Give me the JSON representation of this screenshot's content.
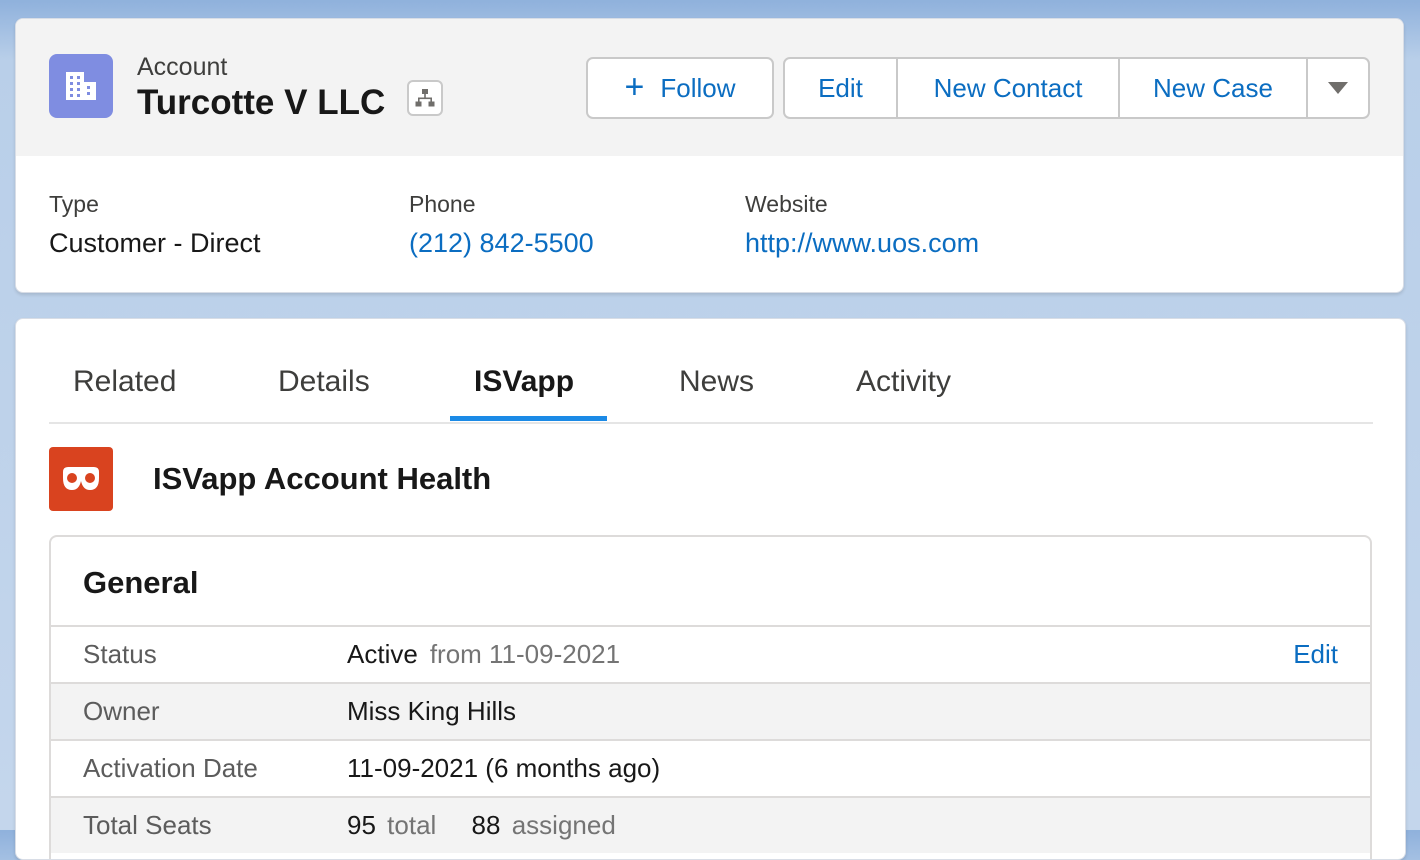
{
  "header": {
    "object_label": "Account",
    "record_title": "Turcotte V LLC",
    "icons": {
      "account": "building-icon",
      "hierarchy": "hierarchy-icon",
      "follow": "plus-icon",
      "more": "caret-down-icon"
    },
    "actions": {
      "follow": "Follow",
      "edit": "Edit",
      "new_contact": "New Contact",
      "new_case": "New Case"
    },
    "fields": {
      "type": {
        "label": "Type",
        "value": "Customer - Direct"
      },
      "phone": {
        "label": "Phone",
        "value": "(212) 842-5500"
      },
      "website": {
        "label": "Website",
        "value": "http://www.uos.com"
      }
    }
  },
  "tabs": [
    {
      "label": "Related"
    },
    {
      "label": "Details"
    },
    {
      "label": "ISVapp",
      "active": true
    },
    {
      "label": "News"
    },
    {
      "label": "Activity"
    }
  ],
  "app": {
    "icon": "isvapp-logo-icon",
    "title": "ISVapp Account Health",
    "section_title": "General",
    "rows": [
      {
        "key": "Status",
        "value": "Active",
        "secondary": "from 11-09-2021",
        "action": "Edit"
      },
      {
        "key": "Owner",
        "value": "Miss King Hills"
      },
      {
        "key": "Activation Date",
        "value": "11-09-2021 (6 months ago)"
      },
      {
        "key": "Total Seats",
        "value_total": "95",
        "total_label": "total",
        "value_assigned": "88",
        "assigned_label": "assigned"
      }
    ]
  },
  "colors": {
    "brand_link": "#0b6dc1",
    "account_icon_bg": "#7f8de1",
    "app_icon_bg": "#d9431f",
    "tab_active_underline": "#1b8ae6",
    "background": "#b9cfe9"
  }
}
